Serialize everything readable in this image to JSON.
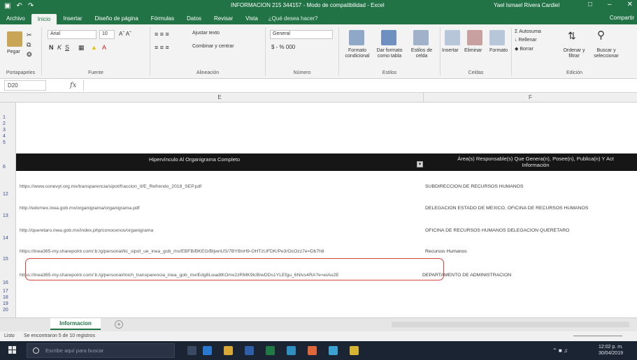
{
  "window": {
    "title": "INFORMACION 215 344157 - Modo de compatibilidad - Excel",
    "user": "Yael Ismael Rivera Cardiel"
  },
  "tabs": [
    "Archivo",
    "Inicio",
    "Insertar",
    "Diseño de página",
    "Fórmulas",
    "Datos",
    "Revisar",
    "Vista"
  ],
  "tell_me": "¿Qué desea hacer?",
  "share": "Compartir",
  "ribbon": {
    "clipboard": {
      "label": "Portapapeles",
      "paste": "Pegar"
    },
    "font": {
      "label": "Fuente",
      "name": "Arial",
      "size": "10"
    },
    "alignment": {
      "label": "Alineación",
      "wrap": "Ajustar texto",
      "merge": "Combinar y centrar"
    },
    "number": {
      "label": "Número",
      "format": "General",
      "currency": "$ - % 000"
    },
    "styles": {
      "label": "Estilos",
      "conditional": "Formato condicional",
      "as_table": "Dar formato como tabla",
      "cell_styles": "Estilos de celda"
    },
    "cells": {
      "label": "Celdas",
      "insert": "Insertar",
      "delete": "Eliminar",
      "format": "Formato"
    },
    "editing": {
      "label": "Edición",
      "autosum": "Autosuma",
      "fill": "Rellenar",
      "clear": "Borrar",
      "sort": "Ordenar y filtrar",
      "find": "Buscar y seleccionar"
    }
  },
  "formula_bar": {
    "name_box": "D20",
    "fx": "fx",
    "value": ""
  },
  "grid": {
    "col_e": "E",
    "col_f": "F",
    "row_numbers": [
      "1",
      "2",
      "3",
      "4",
      "5",
      "6",
      "12",
      "13",
      "14",
      "15",
      "16",
      "17",
      "18",
      "19",
      "20"
    ],
    "header_e": "Hipervínculo Al Organigrama Completo",
    "header_f": "Área(s) Responsable(s) Que Genera(n), Posee(n), Publica(n) Y Act\nInformación",
    "rows": [
      {
        "num": "12",
        "link": "https://www.conevyt.org.mx/transparencia/sipot/fraccion_II/E_Refrendo_2018_SEP.pdf",
        "area": "SUBDIRECCIÓN DE RECURSOS HUMANOS"
      },
      {
        "num": "13",
        "link": "http://edomex.inea.gob.mx/organigrama/organigrama.pdf",
        "area": "DELEGACION ESTADO DE MEXICO, OFICINA DE RECURSOS HUMANOS"
      },
      {
        "num": "14",
        "link": "http://queretaro.inea.gob.mx/index.php/conocenos/organigrama",
        "area": "OFICINA DE RECURSOS HUMANOS DELEGACIÓN QUERÉTARO"
      },
      {
        "num": "15",
        "link": "https://inea365-my.sharepoint.com/:b:/g/personal/lic_sipot_ue_inea_gob_mx/EBFB/BKEG/BljwnUS/7BYBnH9-OHTzUFDK/Pe3/OcOzz7e=Db7h8",
        "area": "Recursos Humanos"
      },
      {
        "num": "16",
        "link": "https://inea365-my.sharepoint.com/:b:/g/personal/mich_transparencia_inea_gob_mx/Edg8LwadtKOmx2zRMK9lcBIwDDs1YLEfgu_6NIvs4RA?e=eiAu2E",
        "area": "DEPARTAMENTO DE ADMINISTRACION"
      }
    ]
  },
  "sheet": {
    "tab": "Informacion",
    "add": "+"
  },
  "status": {
    "mode": "Listo",
    "message": "Se encontraron 5 de 10 registros"
  },
  "taskbar": {
    "search_placeholder": "Escribe aquí para buscar",
    "time": "12:02 p. m.",
    "date": "30/04/2019"
  }
}
